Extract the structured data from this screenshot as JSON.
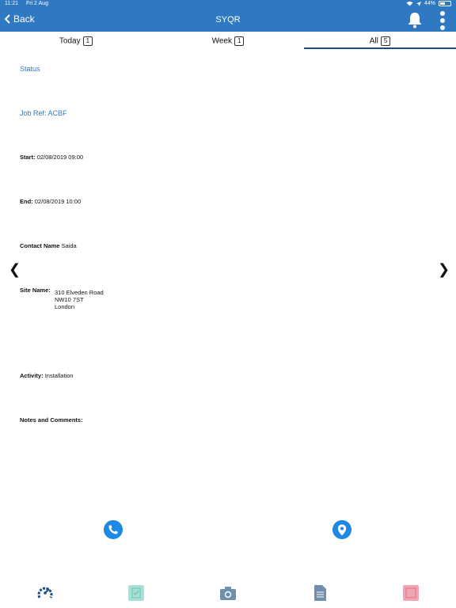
{
  "status_bar": {
    "time": "11:21",
    "date": "Fri 2 Aug",
    "battery": "44%"
  },
  "header": {
    "back_label": "Back",
    "title": "SYQR"
  },
  "tabs": [
    {
      "label": "Today",
      "count": "1"
    },
    {
      "label": "Week",
      "count": "1"
    },
    {
      "label": "All",
      "count": "5",
      "active": true
    }
  ],
  "job": {
    "status_label": "Status",
    "job_ref_label": "Job Ref:",
    "job_ref_value": "ACBF",
    "start_label": "Start:",
    "start_value": "02/08/2019 09:00",
    "end_label": "End:",
    "end_value": "02/08/2019 10:00",
    "contact_label": "Contact Name",
    "contact_value": "Saida",
    "site_label": "Site Name:",
    "site_lines": [
      "310 Elveden Road",
      "NW10 7ST",
      "London"
    ],
    "activity_label": "Activity:",
    "activity_value": "Installation",
    "notes_label": "Notes and Comments:"
  },
  "nav": {
    "prev": "❮",
    "next": "❯"
  },
  "colors": {
    "header": "#2f79c3",
    "accent": "#1e88e5"
  }
}
